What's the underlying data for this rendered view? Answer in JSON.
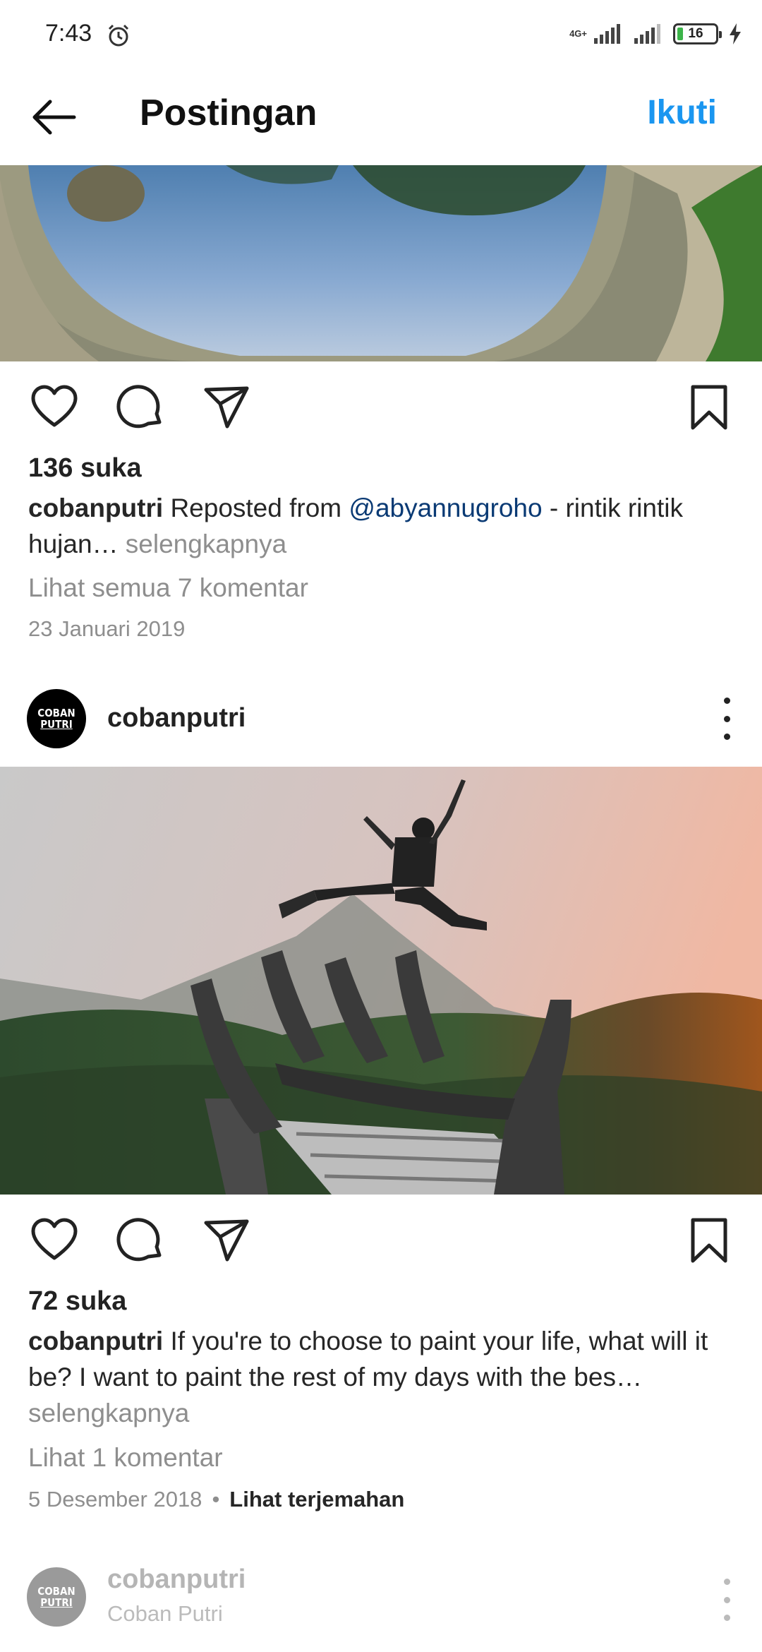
{
  "status_bar": {
    "time": "7:43",
    "network": "4G+",
    "battery": "16",
    "icons": [
      "alarm-icon",
      "signal-icon",
      "signal-icon",
      "battery-icon",
      "charging-icon"
    ]
  },
  "header": {
    "title": "Postingan",
    "follow_label": "Ikuti",
    "back_icon": "back-arrow-icon"
  },
  "colors": {
    "accent": "#1a96f0",
    "mention": "#0a3a74",
    "muted": "#8e8e8e"
  },
  "posts": [
    {
      "likes": "136 suka",
      "username": "cobanputri",
      "caption_before": " Reposted from ",
      "mention": "@abyannugroho",
      "caption_after": " -  rintik rintik hujan",
      "ellipsis": "…",
      "more": " selengkapnya",
      "comments": "Lihat semua 7 komentar",
      "date": "23 Januari 2019"
    },
    {
      "username": "cobanputri",
      "avatar_line1": "COBAN",
      "avatar_line2": "PUTRI",
      "likes": "72 suka",
      "caption": " If you're to choose to paint your life, what will it be? I want to paint the rest of my days with the bes…",
      "more": "selengkapnya",
      "comments": "Lihat 1 komentar",
      "date": "5 Desember 2018",
      "dot": "•",
      "translate": "Lihat terjemahan"
    },
    {
      "username": "cobanputri",
      "subname": "Coban Putri",
      "avatar_line1": "COBAN",
      "avatar_line2": "PUTRI"
    }
  ]
}
